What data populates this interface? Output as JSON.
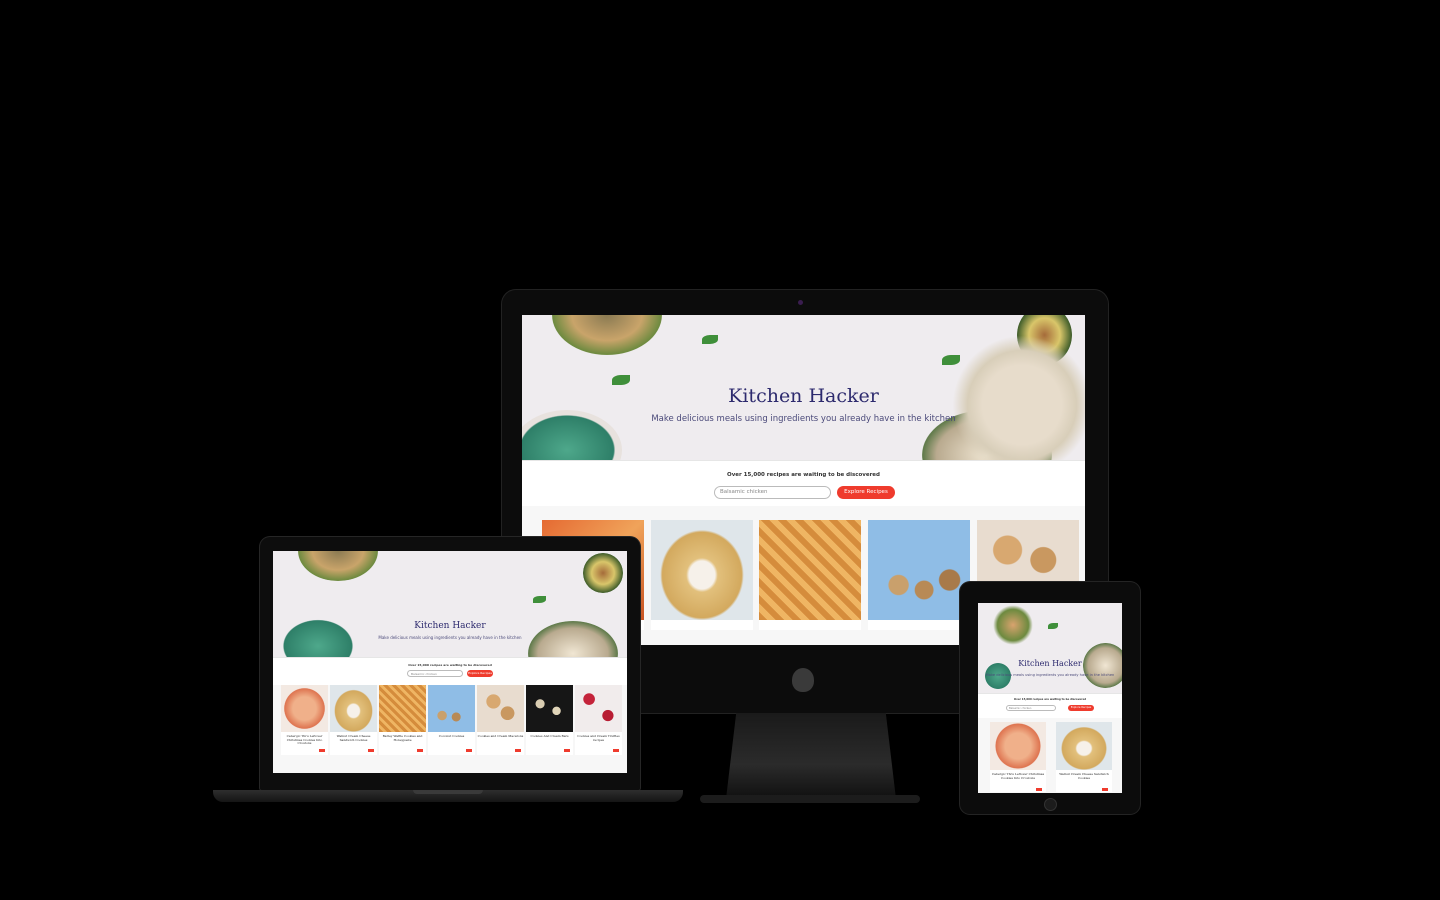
{
  "site": {
    "title": "Kitchen Hacker",
    "subtitle": "Make delicious meals using ingredients you already have in the kitchen",
    "tagline": "Over 15,000 recipes are waiting to be discovered",
    "search_placeholder": "Balsamic chicken",
    "explore_label": "Explore Recipes"
  },
  "colors": {
    "background": "#000000",
    "accent": "#ef3b2d",
    "title": "#2d2a6e"
  },
  "recipes": [
    {
      "title": "Cabergic Thru Leftover Christmas Cookies Into Croutons"
    },
    {
      "title": "Walnut Cream Cheese Sandwich Cookies"
    },
    {
      "title": "Barley Waffle Cookies and Honeypaste"
    },
    {
      "title": "Coconut Cookies"
    },
    {
      "title": "Cookies and Cream Macarons"
    },
    {
      "title": "Cookies And Cream Bars"
    },
    {
      "title": "Cookies and Cream Truffles recipes"
    }
  ]
}
